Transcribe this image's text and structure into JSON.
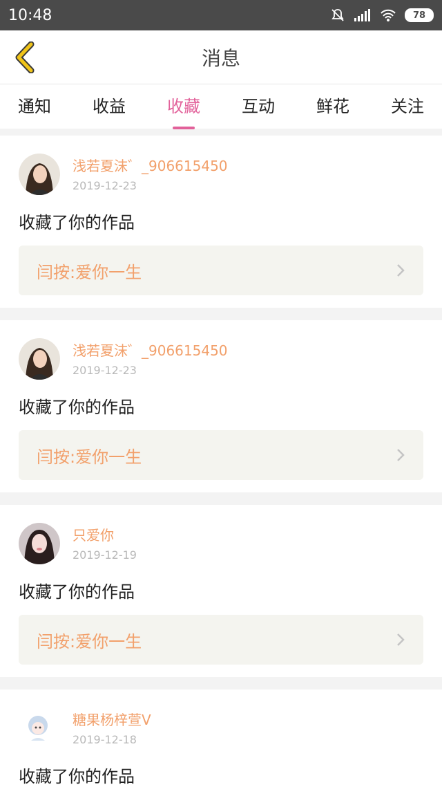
{
  "statusbar": {
    "time": "10:48",
    "battery": "78"
  },
  "header": {
    "title": "消息"
  },
  "tabs": [
    {
      "label": "通知"
    },
    {
      "label": "收益"
    },
    {
      "label": "收藏"
    },
    {
      "label": "互动"
    },
    {
      "label": "鲜花"
    },
    {
      "label": "关注"
    }
  ],
  "active_tab": "收藏",
  "cards": [
    {
      "name": "浅若夏沫゛_906615450",
      "date": "2019-12-23",
      "action": "收藏了你的作品",
      "work": "闫按:爱你一生"
    },
    {
      "name": "浅若夏沫゛_906615450",
      "date": "2019-12-23",
      "action": "收藏了你的作品",
      "work": "闫按:爱你一生"
    },
    {
      "name": "只爱你",
      "date": "2019-12-19",
      "action": "收藏了你的作品",
      "work": "闫按:爱你一生"
    },
    {
      "name": "糖果杨梓萱V",
      "date": "2019-12-18",
      "action": "收藏了你的作品",
      "work": ""
    }
  ],
  "colors": {
    "accent": "#e2619a",
    "name": "#f2a06b",
    "back_icon": "#f0c419"
  }
}
